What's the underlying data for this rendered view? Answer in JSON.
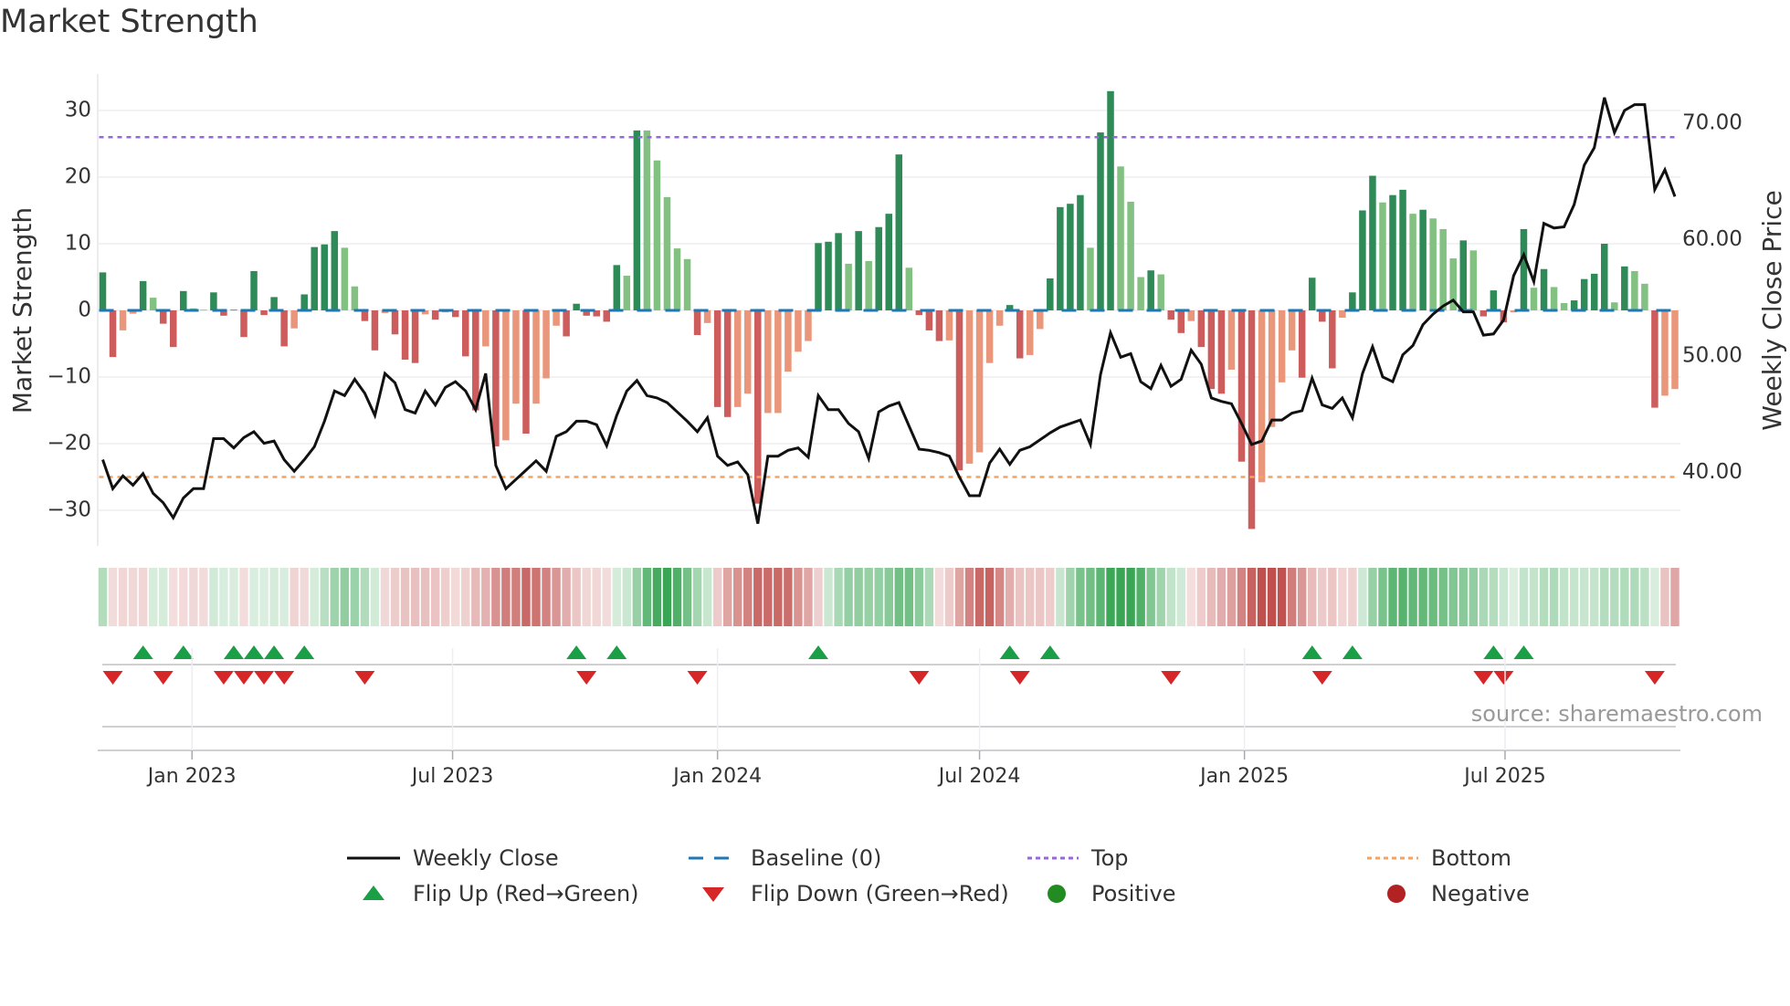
{
  "title": "Market Strength",
  "source": "source: sharemaestro.com",
  "colors": {
    "strong_up": "#2e8b57",
    "weak_up": "#82c182",
    "strong_down": "#cd5c5c",
    "weak_down": "#e9967a",
    "baseline": "#1f77b4",
    "top": "#9966dd",
    "bottom": "#f4a460",
    "price": "#111111",
    "flip_up": "#1a9e46",
    "flip_down": "#d62728",
    "positive": "#228b22",
    "negative": "#b22222"
  },
  "legend": [
    {
      "label": "Weekly Close",
      "icon": "line-icon"
    },
    {
      "label": "Baseline (0)",
      "icon": "dashed-line-icon"
    },
    {
      "label": "Top",
      "icon": "dotted-line-icon"
    },
    {
      "label": "Bottom",
      "icon": "dotted-line-icon"
    },
    {
      "label": "Flip Up (Red→Green)",
      "icon": "triangle-up-icon"
    },
    {
      "label": "Flip Down (Green→Red)",
      "icon": "triangle-down-icon"
    },
    {
      "label": "Positive",
      "icon": "circle-icon"
    },
    {
      "label": "Negative",
      "icon": "circle-icon"
    }
  ],
  "chart_data": {
    "type": "bar",
    "title": "Market Strength",
    "ylabel": "Market Strength",
    "y2label": "Weekly Close Price",
    "ylim": [
      -36,
      36
    ],
    "y2lim": [
      33.2,
      74.9
    ],
    "yticks": [
      30,
      20,
      10,
      0,
      -10,
      -20,
      -30
    ],
    "yticklabels": [
      "30",
      "20",
      "10",
      "0",
      "−10",
      "−20",
      "−30"
    ],
    "y2ticks": [
      70,
      60,
      50,
      40
    ],
    "y2ticklabels": [
      "70.00",
      "60.00",
      "50.00",
      "40.00"
    ],
    "start_date": "2022-10-31",
    "frequency": "weekly",
    "xticks": [
      {
        "date": "2023-01-01",
        "label": "Jan 2023"
      },
      {
        "date": "2023-07-01",
        "label": "Jul 2023"
      },
      {
        "date": "2024-01-01",
        "label": "Jan 2024"
      },
      {
        "date": "2024-07-01",
        "label": "Jul 2024"
      },
      {
        "date": "2025-01-01",
        "label": "Jan 2025"
      },
      {
        "date": "2025-07-01",
        "label": "Jul 2025"
      }
    ],
    "top_level": 26,
    "bottom_level": -25,
    "strength": [
      5.7,
      -7,
      -3,
      -0.5,
      4.4,
      1.9,
      -2,
      -5.5,
      2.9,
      0.3,
      0.1,
      2.7,
      -0.8,
      0.1,
      -4,
      5.9,
      -0.7,
      2,
      -5.4,
      -2.7,
      2.4,
      9.5,
      9.9,
      11.9,
      9.4,
      3.6,
      -1.6,
      -6,
      -0.4,
      -3.6,
      -7.4,
      -7.9,
      -0.6,
      -1.4,
      -0.3,
      -1,
      -6.9,
      -15,
      -5.4,
      -20.4,
      -19.5,
      -14,
      -18.5,
      -14,
      -10.2,
      -2.3,
      -3.9,
      1,
      -0.8,
      -0.9,
      -1.7,
      6.8,
      5.2,
      27,
      27,
      22.5,
      17,
      9.3,
      7.7,
      -3.7,
      -1.9,
      -14.5,
      -16,
      -14.5,
      -12.5,
      -29,
      -15.4,
      -15.4,
      -9.2,
      -6.2,
      -4.6,
      10.1,
      10.3,
      11.6,
      7,
      11.9,
      7.4,
      12.5,
      14.5,
      23.4,
      6.4,
      -0.7,
      -3,
      -4.6,
      -4.5,
      -24,
      -23,
      -21.3,
      -7.9,
      -2.3,
      0.8,
      -7.2,
      -6.7,
      -2.8,
      4.8,
      15.5,
      16,
      17.3,
      9.4,
      26.7,
      32.9,
      21.6,
      16.3,
      5,
      6,
      5.4,
      -1.4,
      -3.4,
      -1.6,
      -5.5,
      -11.8,
      -12.5,
      -8.9,
      -22.7,
      -32.8,
      -25.8,
      -17.5,
      -10.8,
      -6,
      -10.1,
      4.9,
      -1.7,
      -8.7,
      -1.1,
      2.7,
      15,
      20.2,
      16.2,
      17.3,
      18.1,
      14.5,
      15.1,
      13.8,
      12.2,
      7.8,
      10.5,
      9,
      -0.9,
      3,
      -1.8,
      -0.3,
      12.2,
      3.4,
      6.2,
      3.5,
      1.1,
      1.5,
      4.7,
      5.5,
      10,
      1.2,
      6.6,
      5.9,
      4,
      -14.6,
      -12.8,
      -11.8
    ],
    "weekly_close": [
      41.1,
      38.6,
      39.7,
      38.9,
      39.9,
      38.2,
      37.4,
      36.1,
      37.8,
      38.6,
      38.6,
      42.9,
      42.9,
      42.1,
      43.0,
      43.5,
      42.5,
      42.7,
      41.1,
      40.1,
      41.1,
      42.2,
      44.4,
      47.0,
      46.6,
      48.0,
      46.8,
      44.9,
      48.5,
      47.7,
      45.4,
      45.1,
      47.0,
      45.8,
      47.3,
      47.8,
      47.0,
      45.4,
      48.5,
      40.6,
      38.6,
      39.4,
      40.2,
      41.0,
      40.1,
      43.1,
      43.5,
      44.4,
      44.4,
      44.1,
      42.3,
      44.9,
      47.0,
      47.9,
      46.6,
      46.4,
      46.0,
      45.2,
      44.4,
      43.5,
      44.7,
      41.4,
      40.6,
      40.9,
      39.8,
      35.6,
      41.4,
      41.4,
      41.9,
      42.1,
      41.3,
      46.6,
      45.4,
      45.4,
      44.2,
      43.5,
      41.2,
      45.2,
      45.7,
      46.0,
      44.0,
      42.0,
      41.9,
      41.7,
      41.4,
      39.6,
      38.0,
      38.0,
      40.8,
      42.0,
      40.7,
      41.9,
      42.2,
      42.8,
      43.4,
      43.9,
      44.2,
      44.5,
      42.4,
      48.4,
      52.0,
      49.9,
      50.2,
      47.8,
      47.2,
      49.2,
      47.4,
      48.0,
      50.5,
      49.3,
      46.4,
      46.1,
      45.9,
      44.2,
      42.4,
      42.7,
      44.5,
      44.5,
      45.1,
      45.3,
      48.1,
      45.8,
      45.5,
      46.4,
      44.7,
      48.5,
      50.8,
      48.2,
      47.8,
      50.1,
      50.9,
      52.7,
      53.6,
      54.3,
      54.8,
      53.8,
      53.8,
      51.8,
      51.9,
      53.1,
      56.9,
      58.7,
      56.4,
      61.4,
      61.0,
      61.1,
      63.0,
      66.4,
      67.9,
      72.2,
      69.2,
      71.1,
      71.6,
      71.6,
      64.3,
      66.0,
      63.7
    ],
    "flip_up_index": [
      4,
      8,
      13,
      15,
      17,
      20,
      47,
      51,
      71,
      90,
      94,
      120,
      124,
      138,
      141
    ],
    "flip_down_index": [
      1,
      6,
      12,
      14,
      16,
      18,
      26,
      48,
      59,
      81,
      91,
      106,
      121,
      137,
      139,
      154
    ]
  }
}
